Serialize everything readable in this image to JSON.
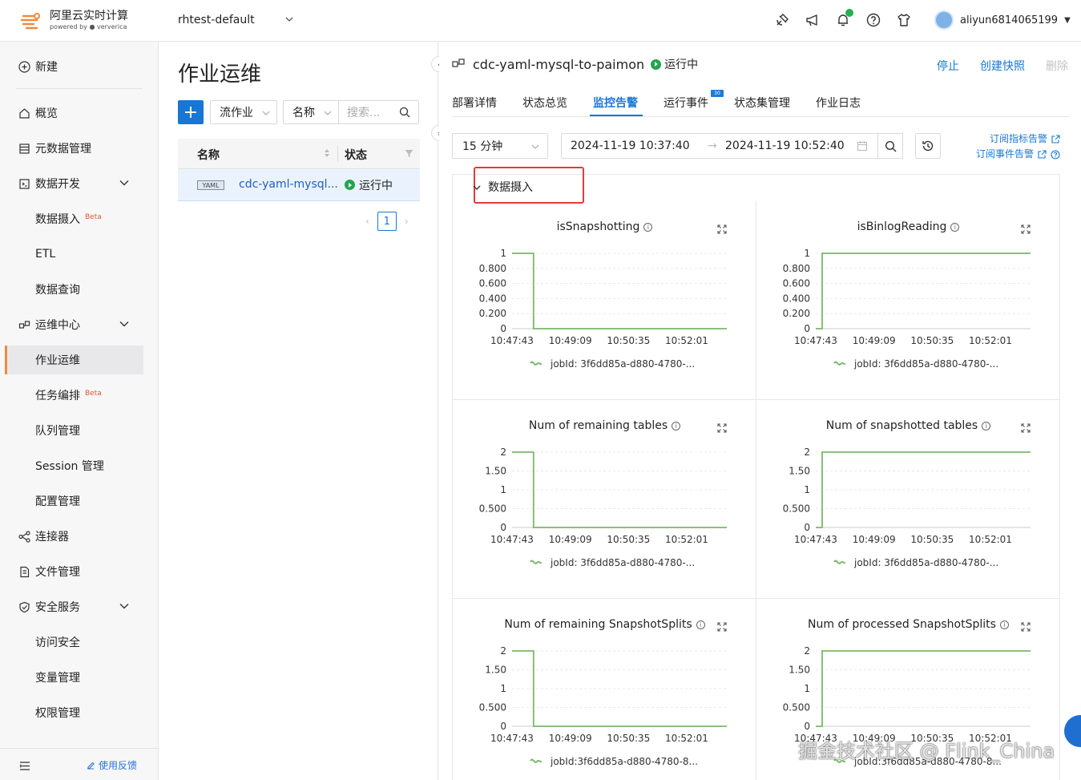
{
  "brand": {
    "name": "阿里云实时计算",
    "powered": "powered by",
    "partner": "ververica"
  },
  "workspace": "rhtest-default",
  "user": {
    "name": "aliyun6814065199"
  },
  "nav": {
    "new": "新建",
    "items": [
      {
        "label": "概览",
        "icon": "home-icon"
      },
      {
        "label": "元数据管理",
        "icon": "database-icon"
      },
      {
        "label": "数据开发",
        "icon": "code-icon"
      },
      {
        "label": "数据摄入",
        "badge": "Beta"
      },
      {
        "label": "ETL"
      },
      {
        "label": "数据查询"
      },
      {
        "label": "运维中心",
        "icon": "ops-icon"
      },
      {
        "label": "作业运维"
      },
      {
        "label": "任务编排",
        "badge": "Beta"
      },
      {
        "label": "队列管理"
      },
      {
        "label": "Session 管理"
      },
      {
        "label": "配置管理"
      },
      {
        "label": "连接器",
        "icon": "connector-icon"
      },
      {
        "label": "文件管理",
        "icon": "file-icon"
      },
      {
        "label": "安全服务",
        "icon": "shield-icon"
      },
      {
        "label": "访问安全"
      },
      {
        "label": "变量管理"
      },
      {
        "label": "权限管理"
      }
    ],
    "feedback": "使用反馈"
  },
  "list": {
    "title": "作业运维",
    "type_select": "流作业",
    "field_select": "名称",
    "search_placeholder": "搜索...",
    "col_name": "名称",
    "col_status": "状态",
    "rows": [
      {
        "tag": "YAML",
        "name": "cdc-yaml-mysql...",
        "status": "运行中"
      }
    ],
    "page": "1"
  },
  "job": {
    "name": "cdc-yaml-mysql-to-paimon",
    "status": "运行中",
    "actions": {
      "stop": "停止",
      "snapshot": "创建快照",
      "delete": "删除"
    }
  },
  "tabs": [
    {
      "label": "部署详情"
    },
    {
      "label": "状态总览"
    },
    {
      "label": "监控告警",
      "active": true
    },
    {
      "label": "运行事件",
      "badge": "30"
    },
    {
      "label": "状态集管理"
    },
    {
      "label": "作业日志"
    }
  ],
  "filters": {
    "range": "15 分钟",
    "start": "2024-11-19 10:37:40",
    "end": "2024-11-19 10:52:40",
    "subscribe_metric": "订阅指标告警",
    "subscribe_event": "订阅事件告警"
  },
  "section": {
    "title": "数据摄入"
  },
  "colors": {
    "accent": "#1877d4",
    "running": "#23a450",
    "line": "#7ab86a",
    "highlight": "#e33b3b"
  },
  "chart_data": [
    {
      "type": "line",
      "title": "isSnapshotting",
      "x": [
        "10:47:43",
        "10:49:09",
        "10:50:35",
        "10:52:01"
      ],
      "yticks": [
        "1",
        "0.800",
        "0.600",
        "0.400",
        "0.200",
        "0"
      ],
      "ylim": [
        0,
        1
      ],
      "series": [
        {
          "name": "jobId: 3f6dd85a-d880-4780-...",
          "points": [
            [
              0,
              1
            ],
            [
              0.1,
              1
            ],
            [
              0.1,
              0
            ],
            [
              1,
              0
            ]
          ]
        }
      ]
    },
    {
      "type": "line",
      "title": "isBinlogReading",
      "x": [
        "10:47:43",
        "10:49:09",
        "10:50:35",
        "10:52:01"
      ],
      "yticks": [
        "1",
        "0.800",
        "0.600",
        "0.400",
        "0.200",
        "0"
      ],
      "ylim": [
        0,
        1
      ],
      "series": [
        {
          "name": "jobId: 3f6dd85a-d880-4780-...",
          "points": [
            [
              0,
              0
            ],
            [
              0.03,
              0
            ],
            [
              0.03,
              1
            ],
            [
              1,
              1
            ]
          ]
        }
      ]
    },
    {
      "type": "line",
      "title": "Num of remaining tables",
      "x": [
        "10:47:43",
        "10:49:09",
        "10:50:35",
        "10:52:01"
      ],
      "yticks": [
        "2",
        "1.50",
        "1",
        "0.500",
        "0"
      ],
      "ylim": [
        0,
        2
      ],
      "series": [
        {
          "name": "jobId: 3f6dd85a-d880-4780-...",
          "points": [
            [
              0,
              2
            ],
            [
              0.1,
              2
            ],
            [
              0.1,
              0
            ],
            [
              1,
              0
            ]
          ]
        }
      ]
    },
    {
      "type": "line",
      "title": "Num of snapshotted tables",
      "x": [
        "10:47:43",
        "10:49:09",
        "10:50:35",
        "10:52:01"
      ],
      "yticks": [
        "2",
        "1.50",
        "1",
        "0.500",
        "0"
      ],
      "ylim": [
        0,
        2
      ],
      "series": [
        {
          "name": "jobId: 3f6dd85a-d880-4780-...",
          "points": [
            [
              0,
              0
            ],
            [
              0.03,
              0
            ],
            [
              0.03,
              2
            ],
            [
              1,
              2
            ]
          ]
        }
      ]
    },
    {
      "type": "line",
      "title": "Num of remaining SnapshotSplits",
      "x": [
        "10:47:43",
        "10:49:09",
        "10:50:35",
        "10:52:01"
      ],
      "yticks": [
        "2",
        "1.50",
        "1",
        "0.500",
        "0"
      ],
      "ylim": [
        0,
        2
      ],
      "series": [
        {
          "name": "jobId:3f6dd85a-d880-4780-8...",
          "points": [
            [
              0,
              2
            ],
            [
              0.1,
              2
            ],
            [
              0.1,
              0
            ],
            [
              1,
              0
            ]
          ]
        }
      ]
    },
    {
      "type": "line",
      "title": "Num of processed SnapshotSplits",
      "x": [
        "10:47:43",
        "10:49:09",
        "10:50:35",
        "10:52:01"
      ],
      "yticks": [
        "2",
        "1.50",
        "1",
        "0.500",
        "0"
      ],
      "ylim": [
        0,
        2
      ],
      "series": [
        {
          "name": "jobId:3f6dd85a-d880-4780-8...",
          "points": [
            [
              0,
              0
            ],
            [
              0.03,
              0
            ],
            [
              0.03,
              2
            ],
            [
              1,
              2
            ]
          ]
        }
      ]
    }
  ],
  "watermark": "掘金技术社区 @ Flink_China"
}
